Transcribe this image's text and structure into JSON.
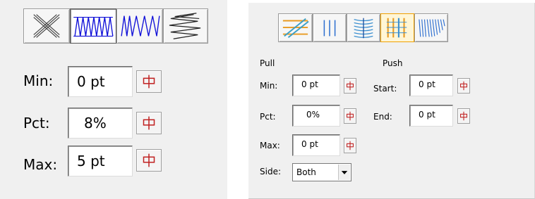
{
  "left_panel": {
    "toolbar": [
      {
        "icon": "x-lines-icon",
        "active": false
      },
      {
        "icon": "warp-zigzag-icon",
        "active": true
      },
      {
        "icon": "skew-zigzag-icon",
        "active": false
      },
      {
        "icon": "layered-zigzag-icon",
        "active": false
      }
    ],
    "min": {
      "label": "Min:",
      "value": "0 pt"
    },
    "pct": {
      "label": "Pct:",
      "value": "8%"
    },
    "max": {
      "label": "Max:",
      "value": "5 pt"
    }
  },
  "right_panel": {
    "toolbar": [
      {
        "icon": "diagonal-orange-icon",
        "active": false
      },
      {
        "icon": "vertical-lines-icon",
        "active": false
      },
      {
        "icon": "wave-stitch-icon",
        "active": false
      },
      {
        "icon": "satin-columns-icon",
        "active": true
      },
      {
        "icon": "fan-stitch-icon",
        "active": false
      }
    ],
    "pull": {
      "heading": "Pull",
      "min": {
        "label": "Min:",
        "value": "0 pt"
      },
      "pct": {
        "label": "Pct:",
        "value": "0%"
      },
      "max": {
        "label": "Max:",
        "value": "0 pt"
      },
      "side": {
        "label": "Side:",
        "value": "Both"
      }
    },
    "push": {
      "heading": "Push",
      "start": {
        "label": "Start:",
        "value": "0 pt"
      },
      "end": {
        "label": "End:",
        "value": "0 pt"
      }
    }
  },
  "colors": {
    "panel_bg": "#f0f0f0",
    "icon_blue": "#1010d8",
    "icon_orange": "#e89a20",
    "icon_teal": "#3aa0c8",
    "stepper_red": "#c02020"
  }
}
